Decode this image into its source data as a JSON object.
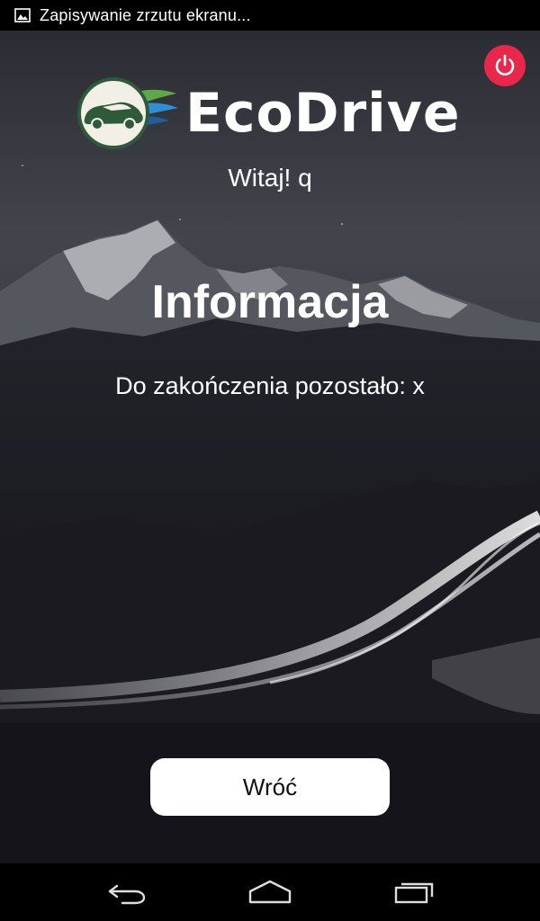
{
  "status_bar": {
    "notification_icon": "image-icon",
    "text": "Zapisywanie zrzutu ekranu..."
  },
  "app": {
    "logo_text": "EcoDrive",
    "greeting": "Witaj! q",
    "title": "Informacja",
    "message": "Do zakończenia pozostało: x",
    "back_button_label": "Wróć",
    "power_icon": "power-icon"
  },
  "nav_bar": {
    "back_icon": "back-icon",
    "home_icon": "home-icon",
    "recents_icon": "recents-icon"
  },
  "colors": {
    "power_button": "#e8274a",
    "logo_green_dark": "#2f5a3a",
    "logo_green_light": "#5fa84a",
    "logo_blue": "#2e8fd6"
  }
}
